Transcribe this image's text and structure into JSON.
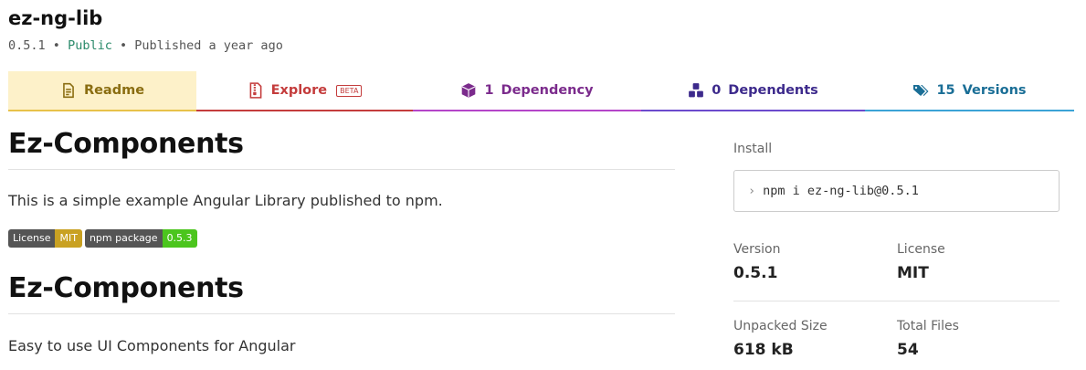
{
  "package": {
    "name": "ez-ng-lib",
    "version": "0.5.1",
    "sep1": "•",
    "visibility": "Public",
    "sep2": "•",
    "published": "Published a year ago"
  },
  "tabs": [
    {
      "label": "Readme",
      "icon": "document-icon",
      "color": "#8a6d11"
    },
    {
      "label": "Explore",
      "badge": "BETA",
      "icon": "file-zip-icon",
      "color": "#c43c3c"
    },
    {
      "count": "1",
      "label": "Dependency",
      "icon": "box-icon",
      "color": "#7b2b8c"
    },
    {
      "count": "0",
      "label": "Dependents",
      "icon": "boxes-icon",
      "color": "#3d2a8c"
    },
    {
      "count": "15",
      "label": "Versions",
      "icon": "tags-icon",
      "color": "#1a6e96"
    }
  ],
  "readme": {
    "heading1": "Ez-Components",
    "para1": "This is a simple example Angular Library published to npm.",
    "badges": [
      {
        "left": "License",
        "right": "MIT",
        "color": "#c9a122"
      },
      {
        "left": "npm package",
        "right": "0.5.3",
        "color": "#4bc51d"
      }
    ],
    "heading2": "Ez-Components",
    "para2": "Easy to use UI Components for Angular"
  },
  "sidebar": {
    "install_label": "Install",
    "install_prompt": "›",
    "install_command": "npm i ez-ng-lib@0.5.1",
    "version_label": "Version",
    "version_value": "0.5.1",
    "license_label": "License",
    "license_value": "MIT",
    "unpacked_label": "Unpacked Size",
    "unpacked_value": "618 kB",
    "files_label": "Total Files",
    "files_value": "54"
  }
}
